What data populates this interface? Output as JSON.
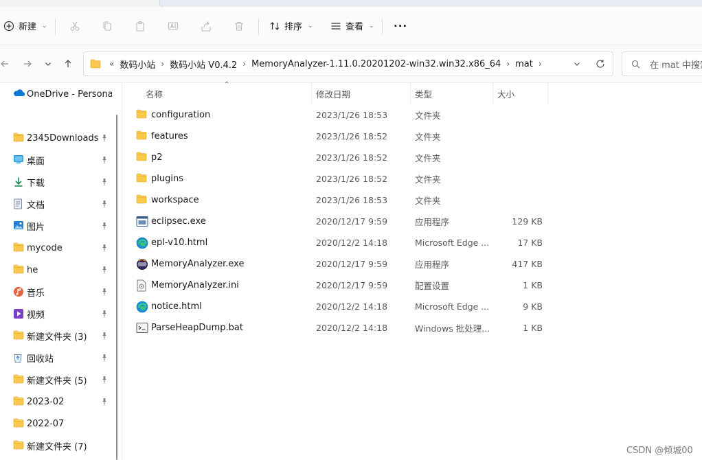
{
  "toolbar": {
    "new_label": "新建",
    "sort_label": "排序",
    "view_label": "查看",
    "more_label": "···"
  },
  "address": {
    "overflow": "«",
    "crumbs": [
      "数码小站",
      "数码小站 V0.4.2",
      "MemoryAnalyzer-1.11.0.20201202-win32.win32.x86_64",
      "mat"
    ],
    "separator": "›"
  },
  "search": {
    "placeholder": "在 mat 中搜索"
  },
  "sidebar": {
    "items": [
      {
        "label": "OneDrive - Personal",
        "icon": "onedrive-icon",
        "pinned": false
      },
      {
        "label": "2345Downloads",
        "icon": "folder-icon",
        "pinned": true
      },
      {
        "label": "桌面",
        "icon": "desktop-icon",
        "pinned": true
      },
      {
        "label": "下载",
        "icon": "download-icon",
        "pinned": true
      },
      {
        "label": "文档",
        "icon": "document-icon",
        "pinned": true
      },
      {
        "label": "图片",
        "icon": "pictures-icon",
        "pinned": true
      },
      {
        "label": "mycode",
        "icon": "folder-icon",
        "pinned": true
      },
      {
        "label": "he",
        "icon": "folder-icon",
        "pinned": true
      },
      {
        "label": "音乐",
        "icon": "music-icon",
        "pinned": true
      },
      {
        "label": "视频",
        "icon": "video-icon",
        "pinned": true
      },
      {
        "label": "新建文件夹 (3)",
        "icon": "folder-icon",
        "pinned": true
      },
      {
        "label": "回收站",
        "icon": "recycle-bin-icon",
        "pinned": true
      },
      {
        "label": "新建文件夹 (5)",
        "icon": "folder-icon",
        "pinned": true
      },
      {
        "label": "2023-02",
        "icon": "folder-icon",
        "pinned": true
      },
      {
        "label": "2022-07",
        "icon": "folder-icon",
        "pinned": false
      },
      {
        "label": "新建文件夹 (7)",
        "icon": "folder-icon",
        "pinned": false
      }
    ]
  },
  "columns": {
    "name": "名称",
    "modified": "修改日期",
    "type": "类型",
    "size": "大小"
  },
  "files": [
    {
      "name": "configuration",
      "modified": "2023/1/26 18:53",
      "type": "文件夹",
      "size": "",
      "icon": "folder-icon"
    },
    {
      "name": "features",
      "modified": "2023/1/26 18:52",
      "type": "文件夹",
      "size": "",
      "icon": "folder-icon"
    },
    {
      "name": "p2",
      "modified": "2023/1/26 18:52",
      "type": "文件夹",
      "size": "",
      "icon": "folder-icon"
    },
    {
      "name": "plugins",
      "modified": "2023/1/26 18:52",
      "type": "文件夹",
      "size": "",
      "icon": "folder-icon"
    },
    {
      "name": "workspace",
      "modified": "2023/1/26 18:53",
      "type": "文件夹",
      "size": "",
      "icon": "folder-icon"
    },
    {
      "name": "eclipsec.exe",
      "modified": "2020/12/17 9:59",
      "type": "应用程序",
      "size": "129 KB",
      "icon": "exe-icon"
    },
    {
      "name": "epl-v10.html",
      "modified": "2020/12/2 14:18",
      "type": "Microsoft Edge ...",
      "size": "17 KB",
      "icon": "edge-icon"
    },
    {
      "name": "MemoryAnalyzer.exe",
      "modified": "2020/12/17 9:59",
      "type": "应用程序",
      "size": "417 KB",
      "icon": "eclipse-icon"
    },
    {
      "name": "MemoryAnalyzer.ini",
      "modified": "2020/12/17 9:59",
      "type": "配置设置",
      "size": "1 KB",
      "icon": "ini-icon"
    },
    {
      "name": "notice.html",
      "modified": "2020/12/2 14:18",
      "type": "Microsoft Edge ...",
      "size": "9 KB",
      "icon": "edge-icon"
    },
    {
      "name": "ParseHeapDump.bat",
      "modified": "2020/12/2 14:18",
      "type": "Windows 批处理...",
      "size": "1 KB",
      "icon": "bat-icon"
    }
  ],
  "watermark": "CSDN @倾城00",
  "colors": {
    "folder": "#f8c94a",
    "accent": "#0067c0",
    "edge": "#1b8fd6"
  }
}
